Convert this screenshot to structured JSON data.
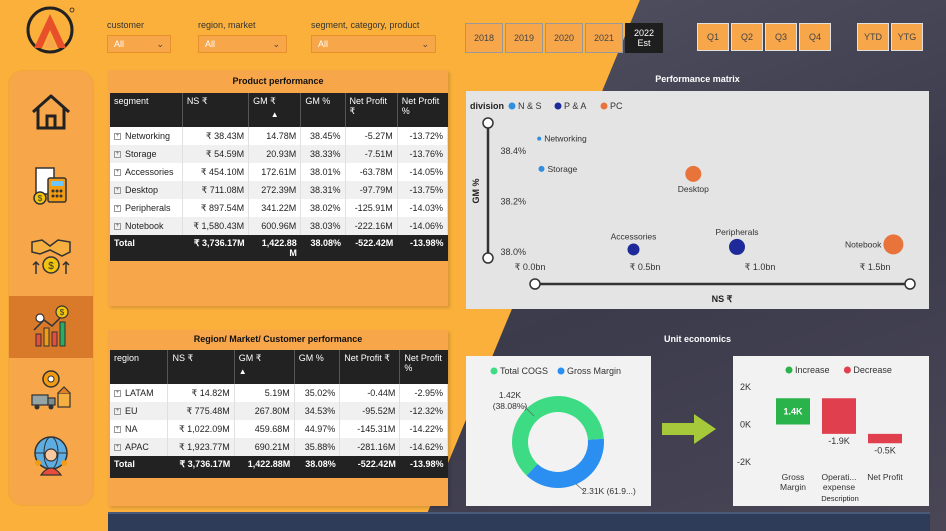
{
  "slicers": [
    {
      "label": "customer",
      "value": "All"
    },
    {
      "label": "region, market",
      "value": "All"
    },
    {
      "label": "segment, category, product",
      "value": "All"
    }
  ],
  "years": [
    "2018",
    "2019",
    "2020",
    "2021"
  ],
  "selected_year": {
    "line1": "2022",
    "line2": "Est"
  },
  "quarters": [
    "Q1",
    "Q2",
    "Q3",
    "Q4"
  ],
  "period_buttons": [
    "YTD",
    "YTG"
  ],
  "nav": [
    {
      "icon": "home-icon"
    },
    {
      "icon": "finance-calculator-icon"
    },
    {
      "icon": "handshake-growth-icon"
    },
    {
      "icon": "analytics-chart-icon",
      "active": true
    },
    {
      "icon": "supply-chain-icon"
    },
    {
      "icon": "global-customer-icon"
    }
  ],
  "product_performance": {
    "title": "Product performance",
    "headers": [
      "segment",
      "NS ₹",
      "GM ₹",
      "GM %",
      "Net Profit ₹",
      "Net Profit %"
    ],
    "rows": [
      [
        "Networking",
        "₹ 38.43M",
        "14.78M",
        "38.45%",
        "-5.27M",
        "-13.72%"
      ],
      [
        "Storage",
        "₹ 54.59M",
        "20.93M",
        "38.33%",
        "-7.51M",
        "-13.76%"
      ],
      [
        "Accessories",
        "₹ 454.10M",
        "172.61M",
        "38.01%",
        "-63.78M",
        "-14.05%"
      ],
      [
        "Desktop",
        "₹ 711.08M",
        "272.39M",
        "38.31%",
        "-97.79M",
        "-13.75%"
      ],
      [
        "Peripherals",
        "₹ 897.54M",
        "341.22M",
        "38.02%",
        "-125.91M",
        "-14.03%"
      ],
      [
        "Notebook",
        "₹ 1,580.43M",
        "600.96M",
        "38.03%",
        "-222.16M",
        "-14.06%"
      ]
    ],
    "total": [
      "Total",
      "₹ 3,736.17M",
      "1,422.88 M",
      "38.08%",
      "-522.42M",
      "-13.98%"
    ]
  },
  "region_performance": {
    "title": "Region/ Market/ Customer performance",
    "headers": [
      "region",
      "NS ₹",
      "GM ₹",
      "GM %",
      "Net Profit ₹",
      "Net Profit %"
    ],
    "rows": [
      [
        "LATAM",
        "₹ 14.82M",
        "5.19M",
        "35.02%",
        "-0.44M",
        "-2.95%"
      ],
      [
        "EU",
        "₹ 775.48M",
        "267.80M",
        "34.53%",
        "-95.52M",
        "-12.32%"
      ],
      [
        "NA",
        "₹ 1,022.09M",
        "459.68M",
        "44.97%",
        "-145.31M",
        "-14.22%"
      ],
      [
        "APAC",
        "₹ 1,923.77M",
        "690.21M",
        "35.88%",
        "-281.16M",
        "-14.62%"
      ]
    ],
    "total": [
      "Total",
      "₹ 3,736.17M",
      "1,422.88M",
      "38.08%",
      "-522.42M",
      "-13.98%"
    ]
  },
  "chart_data": [
    {
      "type": "scatter",
      "title": "Performance matrix",
      "legend_title": "division",
      "legend_position": "top-left",
      "series": [
        {
          "name": "N & S",
          "color": "#2f8fe0"
        },
        {
          "name": "P & A",
          "color": "#1f2a9a"
        },
        {
          "name": "PC",
          "color": "#e8743b"
        }
      ],
      "points": [
        {
          "label": "Networking",
          "series": "N & S",
          "x": 0.04,
          "y": 38.45,
          "size": 2
        },
        {
          "label": "Storage",
          "series": "N & S",
          "x": 0.05,
          "y": 38.33,
          "size": 3
        },
        {
          "label": "Desktop",
          "series": "PC",
          "x": 0.71,
          "y": 38.31,
          "size": 8
        },
        {
          "label": "Accessories",
          "series": "P & A",
          "x": 0.45,
          "y": 38.01,
          "size": 6
        },
        {
          "label": "Peripherals",
          "series": "P & A",
          "x": 0.9,
          "y": 38.02,
          "size": 8
        },
        {
          "label": "Notebook",
          "series": "PC",
          "x": 1.58,
          "y": 38.03,
          "size": 10
        }
      ],
      "xlabel": "NS ₹",
      "ylabel": "GM %",
      "x_ticks": [
        "₹ 0.0bn",
        "₹ 0.5bn",
        "₹ 1.0bn",
        "₹ 1.5bn"
      ],
      "x_tick_values": [
        0,
        0.5,
        1.0,
        1.5
      ],
      "y_ticks": [
        "38.0%",
        "38.2%",
        "38.4%"
      ],
      "y_tick_values": [
        38.0,
        38.2,
        38.4
      ],
      "xlim": [
        0,
        1.6
      ],
      "ylim": [
        37.98,
        38.52
      ]
    },
    {
      "type": "pie",
      "title": "Unit economics",
      "legend": [
        "Total COGS",
        "Gross Margin"
      ],
      "categories": [
        "Total COGS",
        "Gross Margin"
      ],
      "values": [
        2.31,
        1.42
      ],
      "colors": [
        "#3ddc84",
        "#2a8ff0"
      ],
      "labels": [
        {
          "text": "2.31K (61.9...)"
        },
        {
          "text": "1.42K",
          "text2": "(38.08%)"
        }
      ]
    },
    {
      "type": "bar",
      "subtype": "waterfall",
      "legend": [
        {
          "name": "Increase",
          "color": "#2bb34b"
        },
        {
          "name": "Decrease",
          "color": "#e0404e"
        }
      ],
      "categories": [
        "Gross Margin",
        "Operati... expense",
        "Net Profit"
      ],
      "category_lines": [
        [
          "Gross",
          "Margin"
        ],
        [
          "Operati...",
          "expense"
        ],
        [
          "Net Profit"
        ]
      ],
      "values": [
        1.4,
        -1.9,
        -0.5
      ],
      "data_labels": [
        "1.4K",
        "-1.9K",
        "-0.5K"
      ],
      "y_ticks": [
        "2K",
        "0K",
        "-2K"
      ],
      "y_tick_values": [
        2,
        0,
        -2
      ],
      "xlabel": "Description",
      "ylim": [
        -2,
        2
      ]
    }
  ]
}
